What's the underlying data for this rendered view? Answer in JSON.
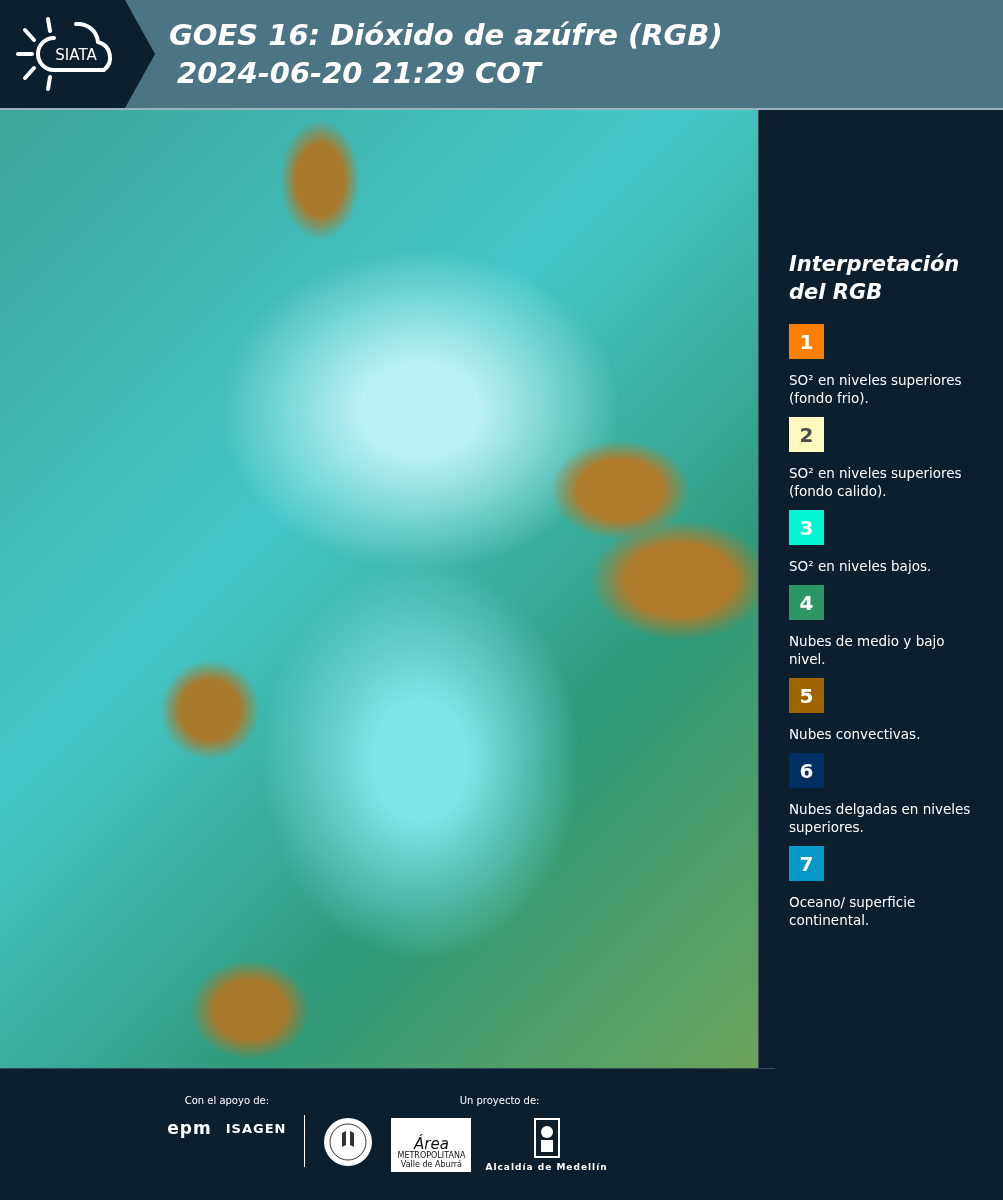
{
  "header": {
    "logo_text": "SIATA",
    "title_lines": [
      "GOES 16: Dióxido de azúfre (RGB)",
      "2024-06-20 21:29 COT"
    ]
  },
  "legend": {
    "title_lines": [
      "Interpretación",
      "del RGB"
    ],
    "items": [
      {
        "number": "1",
        "color": "#ff7f00",
        "label": "SO² en niveles superiores (fondo frio)."
      },
      {
        "number": "2",
        "color": "#fff8bf",
        "label": "SO² en niveles superiores (fondo calido)."
      },
      {
        "number": "3",
        "color": "#00f5d0",
        "label": "SO² en niveles bajos."
      },
      {
        "number": "4",
        "color": "#2e9566",
        "label": "Nubes de medio y bajo nivel."
      },
      {
        "number": "5",
        "color": "#a06400",
        "label": "Nubes convectivas."
      },
      {
        "number": "6",
        "color": "#002f63",
        "label": "Nubes delgadas en niveles superiores."
      },
      {
        "number": "7",
        "color": "#0499c9",
        "label": "Oceano/ superficie continental."
      }
    ]
  },
  "footer": {
    "support_label": "Con el apoyo de:",
    "project_label": "Un proyecto de:",
    "epm": "epm",
    "isagen": "ISAGEN",
    "area_lines": [
      "Área",
      "METROPOLITANA",
      "Valle de Aburrá"
    ],
    "alcaldia": "Alcaldía de Medellín"
  }
}
